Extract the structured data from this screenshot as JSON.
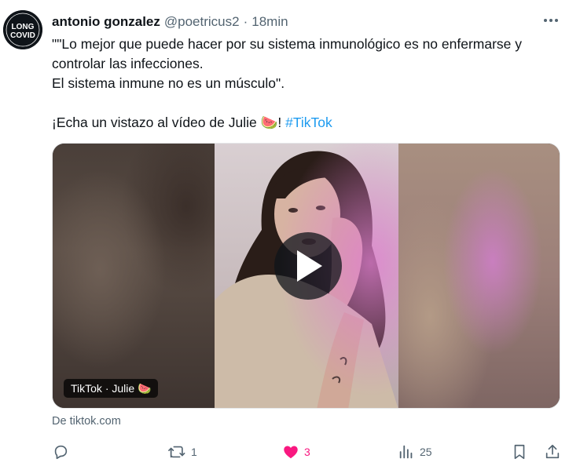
{
  "author": {
    "name": "antonio gonzalez",
    "handle": "@poetricus2",
    "separator": "·",
    "time": "18min",
    "avatar_text_top": "LONG",
    "avatar_text_bottom": "COVID"
  },
  "tweet": {
    "line1": "\"\"Lo mejor que puede hacer por su sistema inmunológico es no enfermarse y controlar las infecciones.",
    "line2": "El sistema inmune no es un músculo\".",
    "line3_prefix": "¡Echa un vistazo al vídeo de Julie 🍉!",
    "hashtag": "#TikTok"
  },
  "card": {
    "video_label": "TikTok · Julie 🍉",
    "source": "De tiktok.com"
  },
  "actions": {
    "reply_count": "",
    "retweet_count": "1",
    "like_count": "3",
    "views_count": "25"
  },
  "colors": {
    "accent": "#1d9bf0",
    "like": "#f91880",
    "muted": "#536471",
    "text": "#0f1419"
  },
  "icons": {
    "more": "more-icon",
    "reply": "reply-icon",
    "retweet": "retweet-icon",
    "like": "heart-icon",
    "views": "views-icon",
    "bookmark": "bookmark-icon",
    "share": "share-icon",
    "play": "play-icon"
  }
}
